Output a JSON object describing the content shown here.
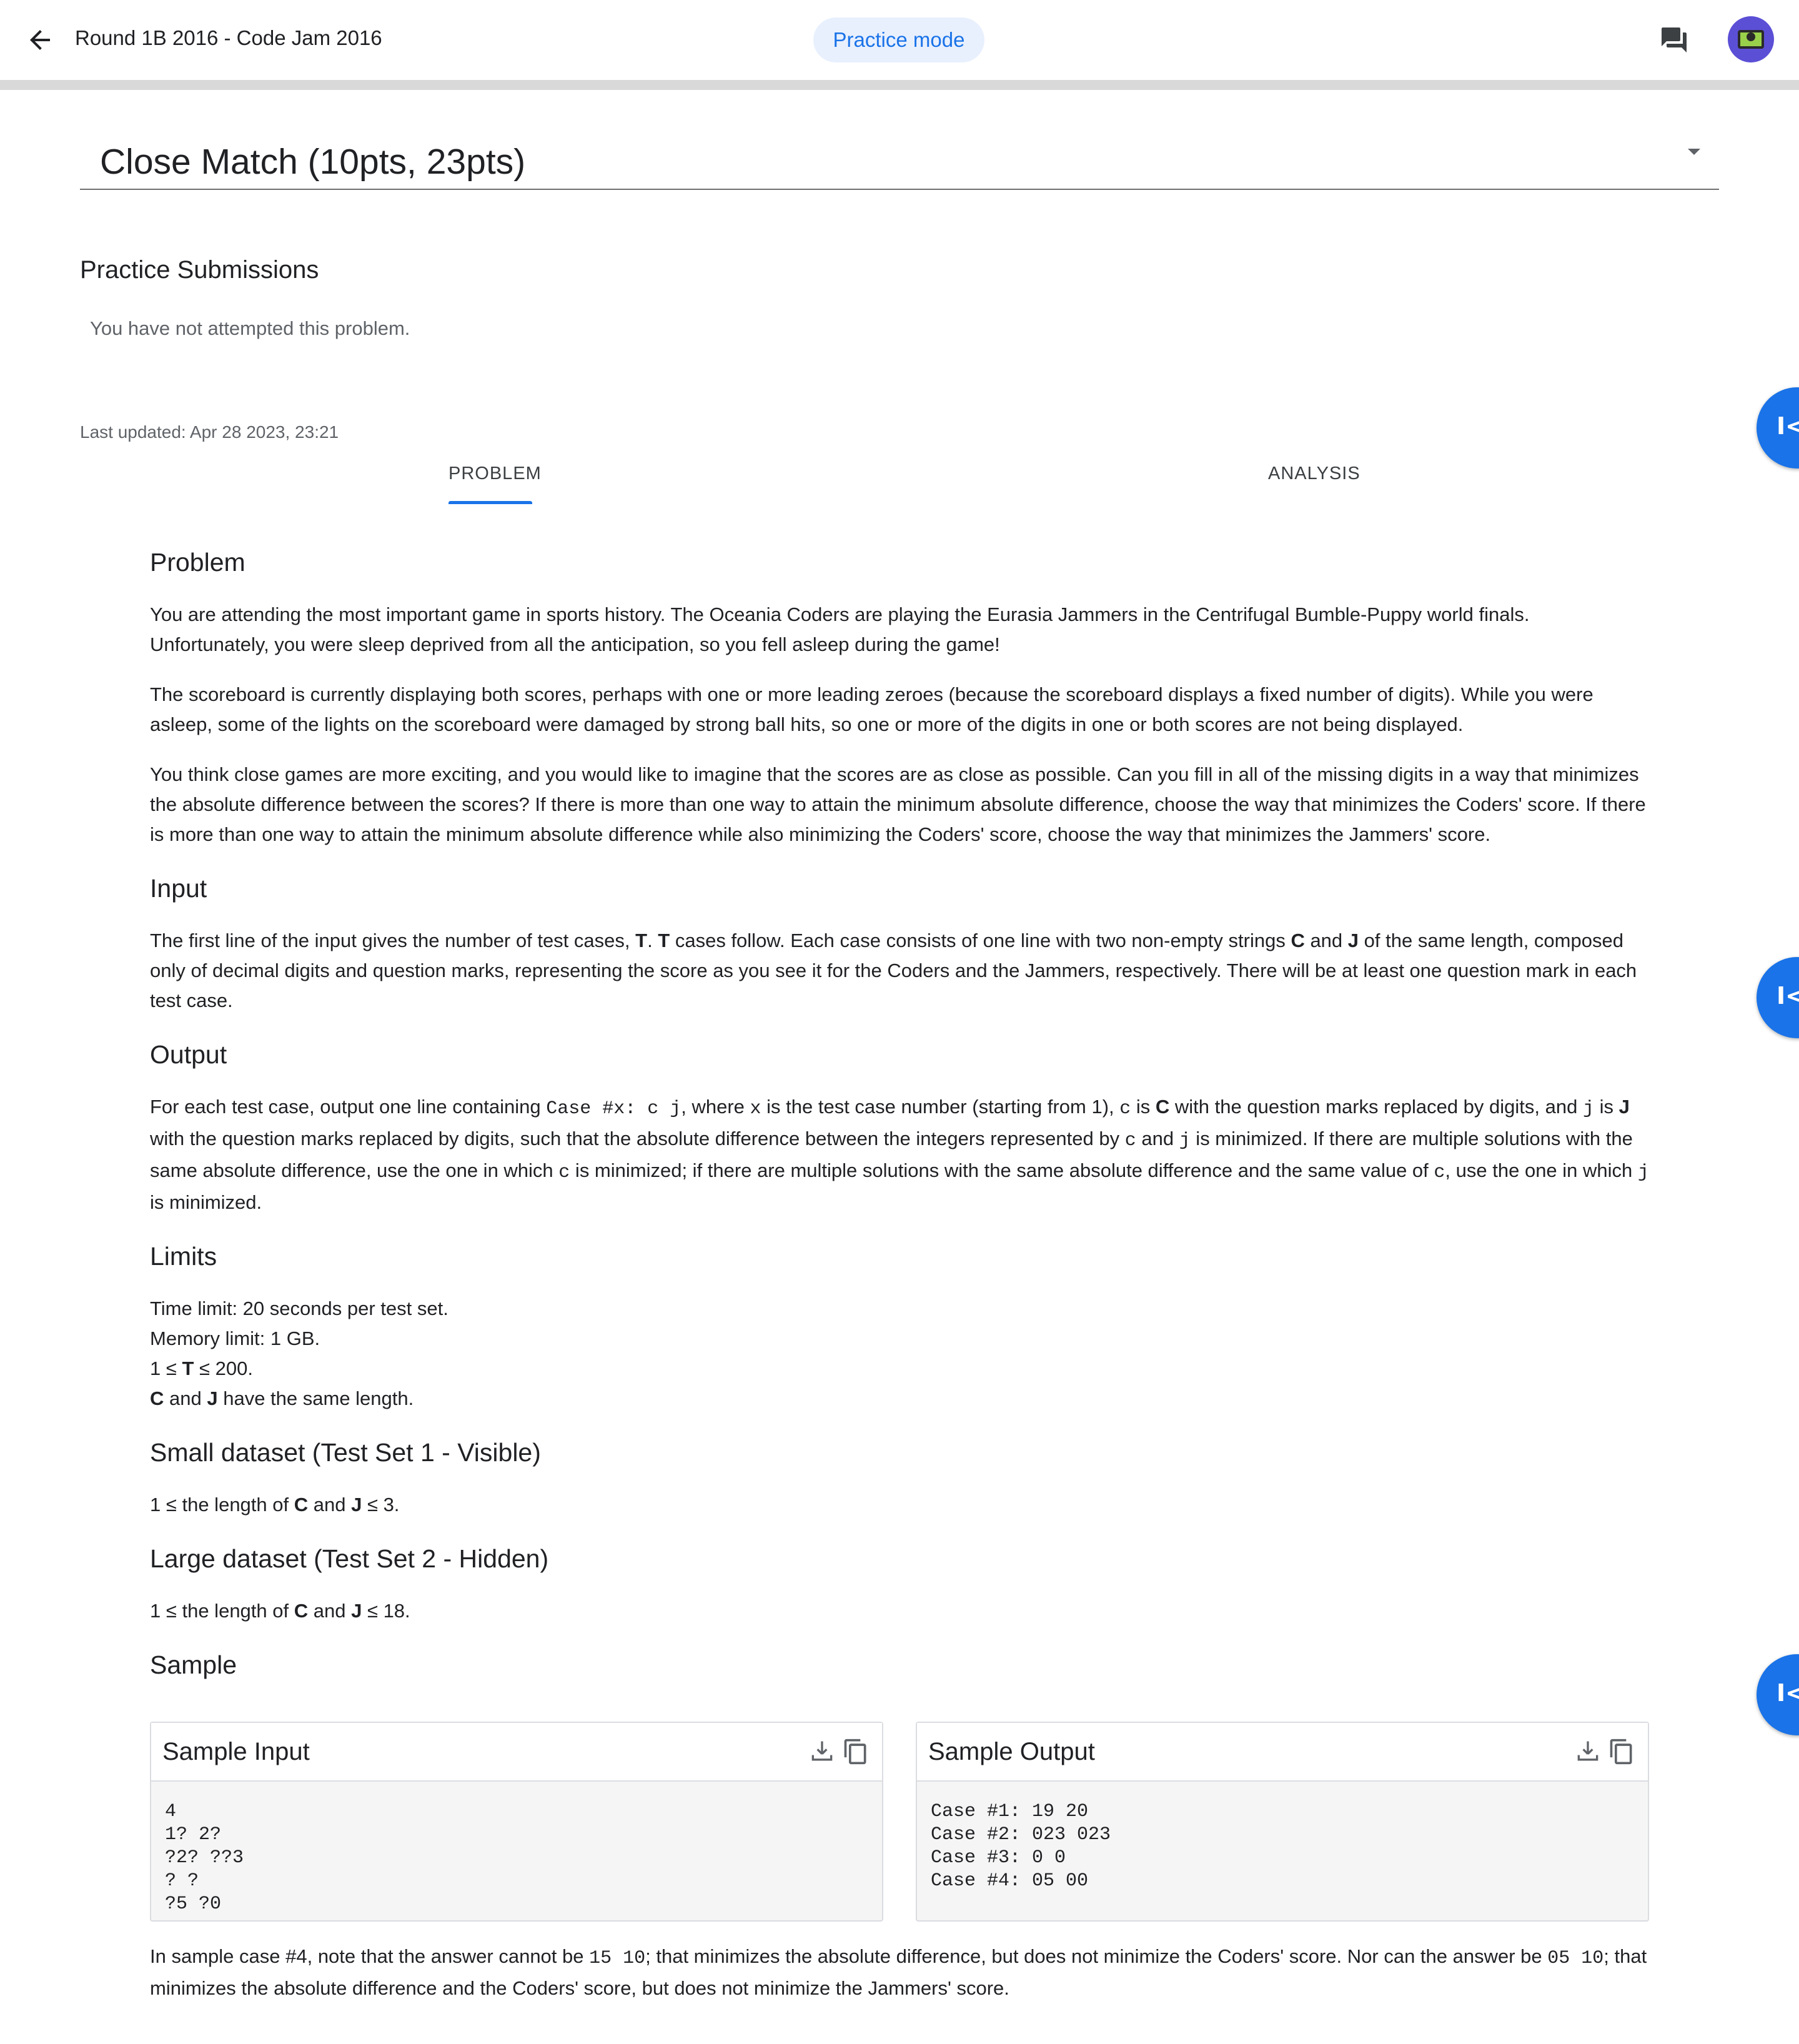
{
  "header": {
    "title": "Round 1B 2016 - Code Jam 2016",
    "mode_chip": "Practice mode"
  },
  "problem_selector": {
    "selected": "Close Match (10pts, 23pts)"
  },
  "submissions": {
    "title": "Practice Submissions",
    "status": "You have not attempted this problem."
  },
  "last_updated": "Last updated: Apr 28 2023, 23:21",
  "tabs": [
    {
      "label": "PROBLEM",
      "active": true
    },
    {
      "label": "ANALYSIS",
      "active": false
    }
  ],
  "side_buttons": [
    "I<",
    "I<",
    "I<"
  ],
  "statement": {
    "problem_heading": "Problem",
    "problem_p1": "You are attending the most important game in sports history. The Oceania Coders are playing the Eurasia Jammers in the Centrifugal Bumble-Puppy world finals. Unfortunately, you were sleep deprived from all the anticipation, so you fell asleep during the game!",
    "problem_p2": "The scoreboard is currently displaying both scores, perhaps with one or more leading zeroes (because the scoreboard displays a fixed number of digits). While you were asleep, some of the lights on the scoreboard were damaged by strong ball hits, so one or more of the digits in one or both scores are not being displayed.",
    "problem_p3": "You think close games are more exciting, and you would like to imagine that the scores are as close as possible. Can you fill in all of the missing digits in a way that minimizes the absolute difference between the scores? If there is more than one way to attain the minimum absolute difference, choose the way that minimizes the Coders' score. If there is more than one way to attain the minimum absolute difference while also minimizing the Coders' score, choose the way that minimizes the Jammers' score.",
    "input_heading": "Input",
    "input_t1": "The first line of the input gives the number of test cases, ",
    "input_T1": "T",
    "input_t2": ". ",
    "input_T2": "T",
    "input_t3": " cases follow. Each case consists of one line with two non-empty strings ",
    "input_C": "C",
    "input_t4": " and ",
    "input_J": "J",
    "input_t5": " of the same length, composed only of decimal digits and question marks, representing the score as you see it for the Coders and the Jammers, respectively. There will be at least one question mark in each test case.",
    "output_heading": "Output",
    "output_t1": "For each test case, output one line containing ",
    "output_code1": "Case #x: c j",
    "output_t2": ", where ",
    "output_x": "x",
    "output_t3": " is the test case number (starting from 1), ",
    "output_c": "c",
    "output_t4": " is ",
    "output_C": "C",
    "output_t5": " with the question marks replaced by digits, and ",
    "output_j": "j",
    "output_t6": " is ",
    "output_J": "J",
    "output_t7": " with the question marks replaced by digits, such that the absolute difference between the integers represented by ",
    "output_c2": "c",
    "output_t8": " and ",
    "output_j2": "j",
    "output_t9": " is minimized. If there are multiple solutions with the same absolute difference, use the one in which ",
    "output_c3": "c",
    "output_t10": " is minimized; if there are multiple solutions with the same absolute difference and the same value of ",
    "output_c4": "c",
    "output_t11": ", use the one in which ",
    "output_j3": "j",
    "output_t12": " is minimized.",
    "limits_heading": "Limits",
    "limits_time": "Time limit: 20 seconds per test set.",
    "limits_memory": "Memory limit: 1 GB.",
    "limits_T_pre": "1 ≤ ",
    "limits_T": "T",
    "limits_T_post": " ≤ 200.",
    "limits_CJ_C": "C",
    "limits_CJ_mid": " and ",
    "limits_CJ_J": "J",
    "limits_CJ_post": " have the same length.",
    "small_heading": "Small dataset (Test Set 1 - Visible)",
    "small_pre": "1 ≤ the length of ",
    "small_C": "C",
    "small_mid": " and ",
    "small_J": "J",
    "small_post": " ≤ 3.",
    "large_heading": "Large dataset (Test Set 2 - Hidden)",
    "large_pre": "1 ≤ the length of ",
    "large_C": "C",
    "large_mid": " and ",
    "large_J": "J",
    "large_post": " ≤ 18.",
    "sample_heading": "Sample"
  },
  "sample_input": {
    "title": "Sample Input",
    "lines": [
      "4",
      "1? 2?",
      "?2? ??3",
      "? ?",
      "?5 ?0"
    ]
  },
  "sample_output": {
    "title": "Sample Output",
    "lines": [
      "Case #1: 19 20",
      "Case #2: 023 023",
      "Case #3: 0 0",
      "Case #4: 05 00"
    ]
  },
  "footnote": {
    "t1": "In sample case #4, note that the answer cannot be ",
    "code1": "15 10",
    "t2": "; that minimizes the absolute difference, but does not minimize the Coders' score. Nor can the answer be ",
    "code2": "05 10",
    "t3": "; that minimizes the absolute difference and the Coders' score, but does not minimize the Jammers' score."
  },
  "colors": {
    "accent": "#1a73e8",
    "chip_bg": "#e8f0fe",
    "muted_text": "#5f6368",
    "sample_bg": "#f5f5f5"
  },
  "icons": [
    "arrow-back-icon",
    "chat-icon",
    "avatar",
    "download-icon",
    "copy-icon",
    "collapse-left-icon"
  ]
}
